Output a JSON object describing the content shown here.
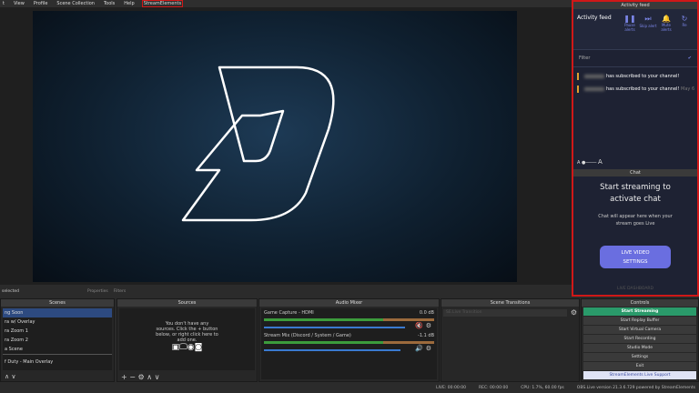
{
  "menu": [
    "t",
    "View",
    "Profile",
    "Scene Collection",
    "Tools",
    "Help",
    "StreamElements"
  ],
  "toolbar": {
    "selected": "selected",
    "properties": "Properties",
    "filters": "Filters"
  },
  "activity": {
    "dock_title": "Activity feed",
    "title": "Activity feed",
    "buttons": [
      {
        "icon": "pause-icon",
        "label": "Pause alerts"
      },
      {
        "icon": "skip-icon",
        "label": "Skip alert"
      },
      {
        "icon": "bell-icon",
        "label": "Mute alerts"
      },
      {
        "icon": "replay-icon",
        "label": "Re"
      }
    ],
    "filter": "Filter",
    "events": [
      {
        "text": "has subscribed to your channel!"
      },
      {
        "text": "has subscribed to your channel!",
        "time": "May 6"
      }
    ],
    "font_small": "A",
    "font_large": "A"
  },
  "chat": {
    "dock_title": "Chat",
    "heading": "Start streaming to activate chat",
    "sub": "Chat will appear here when your stream goes Live",
    "button": "LIVE VIDEO SETTINGS",
    "link": "LIVE DASHBOARD"
  },
  "scenes": {
    "title": "Scenes",
    "items": [
      "ng Soon",
      "ra w/ Overlay",
      "ra Zoom 1",
      "ra Zoom 2",
      "a Scene",
      "f Duty - Main Overlay"
    ]
  },
  "sources": {
    "title": "Sources",
    "empty": "You don't have any sources. Click the + button below, or right click here to add one."
  },
  "mixer": {
    "title": "Audio Mixer",
    "channels": [
      {
        "name": "Game Capture - HDMI",
        "db": "0.0 dB",
        "level": 0.9,
        "muted": true
      },
      {
        "name": "Stream Mix (Discord / System / Game)",
        "db": "-1.1 dB",
        "level": 0.85,
        "muted": false
      }
    ]
  },
  "transitions": {
    "title": "Scene Transitions",
    "value": "SE.Live Transition"
  },
  "controls": {
    "title": "Controls",
    "start_streaming": "Start Streaming",
    "items": [
      "Start Replay Buffer",
      "Start Virtual Camera",
      "Start Recording",
      "Studio Mode",
      "Settings",
      "Exit"
    ],
    "support": "StreamElements Live Support"
  },
  "status": {
    "live": "LIVE: 00:00:00",
    "rec": "REC: 00:00:00",
    "cpu": "CPU: 1.7%, 60.00 fps",
    "version": "OBS.Live version 21.3.6.729 powered by StreamElements"
  },
  "colors": {
    "accent": "#d01818",
    "stream": "#2a9a6a",
    "chat_button": "#6a6ee0"
  }
}
